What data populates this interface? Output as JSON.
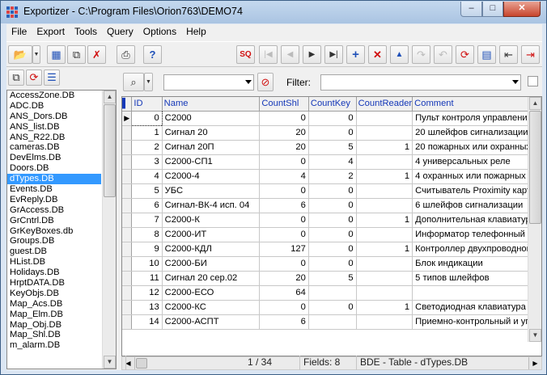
{
  "window": {
    "title": "Exportizer - C:\\Program Files\\Orion763\\DEMO74",
    "minimize": "–",
    "maximize": "□",
    "close": "✕"
  },
  "menu": [
    "File",
    "Export",
    "Tools",
    "Query",
    "Options",
    "Help"
  ],
  "toolbar": {
    "left_icons": [
      "open-folder-icon",
      "dropdown-icon",
      "table-grid-icon",
      "copy-icon",
      "clear-icon",
      "print-icon",
      "help-icon"
    ],
    "nav_icons": [
      "sql-icon",
      "first-icon",
      "prior-icon",
      "next-icon",
      "last-icon",
      "insert-icon",
      "delete-icon",
      "edit-icon",
      "post-icon",
      "cancel-icon",
      "refresh-icon",
      "grid-view-icon",
      "back-icon",
      "export-icon"
    ]
  },
  "filter": {
    "label": "Filter:",
    "value": ""
  },
  "files": [
    "AccessZone.DB",
    "ADC.DB",
    "ANS_Dors.DB",
    "ANS_list.DB",
    "ANS_R22.DB",
    "cameras.DB",
    "DevElms.DB",
    "Doors.DB",
    "dTypes.DB",
    "Events.DB",
    "EvReply.DB",
    "GrAccess.DB",
    "GrCntrl.DB",
    "GrKeyBoxes.db",
    "Groups.DB",
    "guest.DB",
    "HList.DB",
    "Holidays.DB",
    "HrptDATA.DB",
    "KeyObjs.DB",
    "Map_Acs.DB",
    "Map_Elm.DB",
    "Map_Obj.DB",
    "Map_Shl.DB",
    "m_alarm.DB"
  ],
  "selected_file_index": 8,
  "table": {
    "columns": [
      "ID",
      "Name",
      "CountShl",
      "CountKey",
      "CountReader",
      "Comment"
    ],
    "rows": [
      [
        "0",
        "С2000",
        "0",
        "0",
        "",
        "Пульт контроля управления"
      ],
      [
        "1",
        "Сигнал 20",
        "20",
        "0",
        "",
        "20 шлейфов сигнализации, 3"
      ],
      [
        "2",
        "Сигнал 20П",
        "20",
        "5",
        "1",
        "20 пожарных или охранных"
      ],
      [
        "3",
        "С2000-СП1",
        "0",
        "4",
        "",
        "4 универсальных реле"
      ],
      [
        "4",
        "С2000-4",
        "4",
        "2",
        "1",
        "4 охранных или пожарных ш"
      ],
      [
        "5",
        "УБС",
        "0",
        "0",
        "",
        "Считыватель Proximity карт"
      ],
      [
        "6",
        "Сигнал-ВК-4 исп. 04",
        "6",
        "0",
        "",
        "6 шлейфов сигнализации"
      ],
      [
        "7",
        "С2000-К",
        "0",
        "0",
        "1",
        "Дополнительная клавиатура"
      ],
      [
        "8",
        "С2000-ИТ",
        "0",
        "0",
        "",
        "Информатор телефонный"
      ],
      [
        "9",
        "С2000-КДЛ",
        "127",
        "0",
        "1",
        "Контроллер двухпроводной"
      ],
      [
        "10",
        "С2000-БИ",
        "0",
        "0",
        "",
        "Блок индикации"
      ],
      [
        "11",
        "Сигнал 20 сер.02",
        "20",
        "5",
        "",
        "5 типов шлейфов"
      ],
      [
        "12",
        "С2000-ЕСО",
        "64",
        "",
        "",
        ""
      ],
      [
        "13",
        "С2000-КС",
        "0",
        "0",
        "1",
        "Светодиодная клавиатура"
      ],
      [
        "14",
        "С2000-АСПТ",
        "6",
        "",
        "",
        "Приемно-контрольный и упр"
      ]
    ]
  },
  "status": {
    "record": "1 / 34",
    "fields": "Fields: 8",
    "source": "BDE - Table - dTypes.DB"
  }
}
